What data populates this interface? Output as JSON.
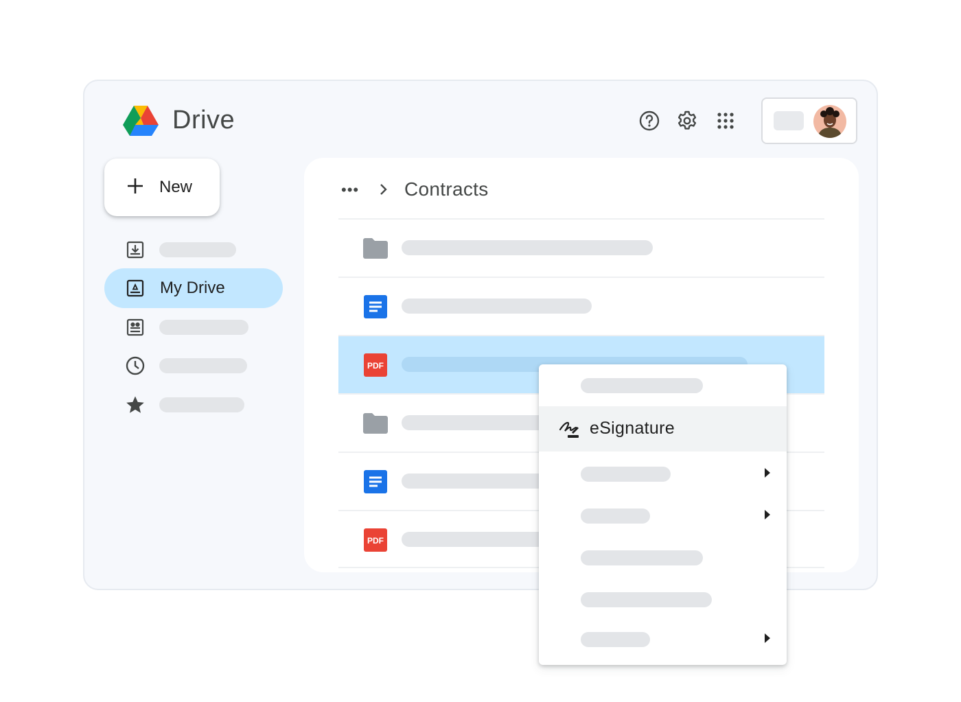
{
  "app": {
    "title": "Drive"
  },
  "header": {
    "icons": [
      "help-icon",
      "settings-gear-icon",
      "apps-grid-icon"
    ],
    "account": {
      "avatar": "avatar"
    }
  },
  "sidebar": {
    "new_button_label": "New",
    "items": [
      {
        "icon": "inbox-download-icon",
        "label": "",
        "active": false
      },
      {
        "icon": "my-drive-icon",
        "label": "My Drive",
        "active": true
      },
      {
        "icon": "shared-contacts-icon",
        "label": "",
        "active": false
      },
      {
        "icon": "recent-clock-icon",
        "label": "",
        "active": false
      },
      {
        "icon": "starred-icon",
        "label": "",
        "active": false
      }
    ]
  },
  "breadcrumb": {
    "more": "•••",
    "current": "Contracts"
  },
  "files": [
    {
      "type": "folder",
      "name": ""
    },
    {
      "type": "docs",
      "name": ""
    },
    {
      "type": "pdf",
      "name": "",
      "selected": true
    },
    {
      "type": "folder",
      "name": ""
    },
    {
      "type": "docs",
      "name": ""
    },
    {
      "type": "pdf",
      "name": ""
    }
  ],
  "file_type_labels": {
    "pdf": "PDF"
  },
  "context_menu": {
    "items": [
      {
        "label": "",
        "submenu": false
      },
      {
        "label": "eSignature",
        "icon": "esignature-icon",
        "highlighted": true
      },
      {
        "label": "",
        "submenu": true
      },
      {
        "label": "",
        "submenu": true
      },
      {
        "label": "",
        "submenu": false
      },
      {
        "label": "",
        "submenu": false
      },
      {
        "label": "",
        "submenu": true
      }
    ]
  },
  "colors": {
    "selection": "#c2e7ff",
    "docs_blue": "#1a73e8",
    "pdf_red": "#ea4335",
    "folder_gray": "#9aa0a6"
  }
}
